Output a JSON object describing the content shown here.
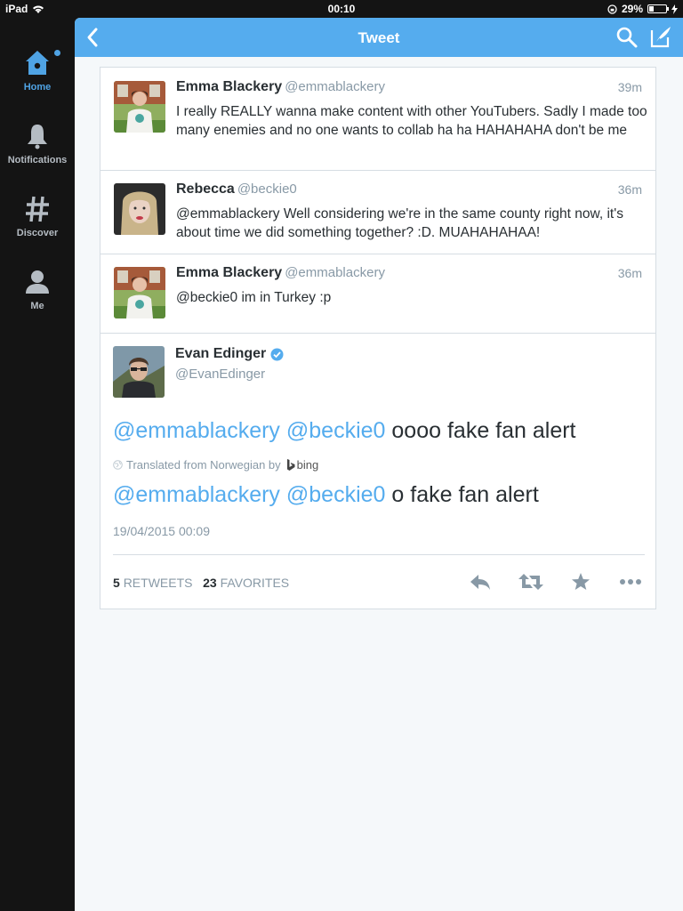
{
  "status_bar": {
    "device": "iPad",
    "time": "00:10",
    "battery": "29%",
    "battery_level": 0.29
  },
  "sidebar": {
    "items": [
      {
        "label": "Home",
        "icon": "home-icon",
        "active": true
      },
      {
        "label": "Notifications",
        "icon": "bell-icon",
        "active": false
      },
      {
        "label": "Discover",
        "icon": "hashtag-icon",
        "active": false
      },
      {
        "label": "Me",
        "icon": "person-icon",
        "active": false
      }
    ]
  },
  "header": {
    "title": "Tweet"
  },
  "conversation": [
    {
      "name": "Emma Blackery",
      "handle": "@emmablackery",
      "time": "39m",
      "text": "I really REALLY wanna make content with other YouTubers. Sadly I made too many enemies and no one wants to collab ha ha HAHAHAHA don't be me"
    },
    {
      "name": "Rebecca",
      "handle": "@beckie0",
      "time": "36m",
      "text": "@emmablackery Well considering we're in the same county right now, it's about time we did something together? :D. MUAHAHAHAA!"
    },
    {
      "name": "Emma Blackery",
      "handle": "@emmablackery",
      "time": "36m",
      "text": "@beckie0 im in Turkey :p"
    }
  ],
  "detail": {
    "name": "Evan Edinger",
    "handle": "@EvanEdinger",
    "mention1": "@emmablackery",
    "mention2": "@beckie0",
    "original_text": "oooo fake fan alert",
    "translated_label": "Translated from Norwegian by",
    "translator": "bing",
    "translated_text": "o fake fan alert",
    "timestamp": "19/04/2015 00:09",
    "retweets_count": "5",
    "retweets_label": "RETWEETS",
    "favorites_count": "23",
    "favorites_label": "FAVORITES"
  },
  "colors": {
    "accent": "#55acee",
    "sidebar_bg": "#141414",
    "text": "#292f33",
    "muted": "#8899a6"
  }
}
